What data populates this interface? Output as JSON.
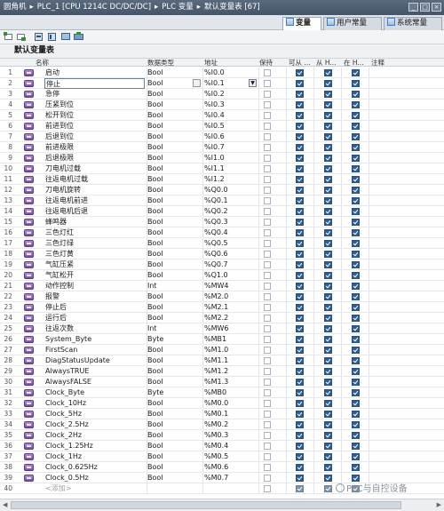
{
  "breadcrumb": [
    "圆角机",
    "PLC_1 [CPU 1214C DC/DC/DC]",
    "PLC 变量",
    "默认变量表 [67]"
  ],
  "tabs": [
    {
      "label": "变量",
      "active": true
    },
    {
      "label": "用户常量",
      "active": false
    },
    {
      "label": "系统常量",
      "active": false
    }
  ],
  "table_title": "默认变量表",
  "columns": {
    "name": "名称",
    "type": "数据类型",
    "address": "地址",
    "retain": "保持",
    "access": "可从 ...",
    "write": "从 H...",
    "visible": "在 H...",
    "comment": "注释"
  },
  "rows": [
    {
      "n": "1",
      "name": "启动",
      "type": "Bool",
      "addr": "%I0.0"
    },
    {
      "n": "2",
      "name": "停止",
      "type": "Bool",
      "addr": "%I0.1"
    },
    {
      "n": "3",
      "name": "急停",
      "type": "Bool",
      "addr": "%I0.2"
    },
    {
      "n": "4",
      "name": "压紧到位",
      "type": "Bool",
      "addr": "%I0.3"
    },
    {
      "n": "5",
      "name": "松开到位",
      "type": "Bool",
      "addr": "%I0.4"
    },
    {
      "n": "6",
      "name": "前进到位",
      "type": "Bool",
      "addr": "%I0.5"
    },
    {
      "n": "7",
      "name": "后退到位",
      "type": "Bool",
      "addr": "%I0.6"
    },
    {
      "n": "8",
      "name": "前进极限",
      "type": "Bool",
      "addr": "%I0.7"
    },
    {
      "n": "9",
      "name": "后退极限",
      "type": "Bool",
      "addr": "%I1.0"
    },
    {
      "n": "10",
      "name": "刀电机过载",
      "type": "Bool",
      "addr": "%I1.1"
    },
    {
      "n": "11",
      "name": "往返电机过载",
      "type": "Bool",
      "addr": "%I1.2"
    },
    {
      "n": "12",
      "name": "刀电机旋转",
      "type": "Bool",
      "addr": "%Q0.0"
    },
    {
      "n": "13",
      "name": "往返电机前进",
      "type": "Bool",
      "addr": "%Q0.1"
    },
    {
      "n": "14",
      "name": "往返电机后退",
      "type": "Bool",
      "addr": "%Q0.2"
    },
    {
      "n": "15",
      "name": "蜂鸣器",
      "type": "Bool",
      "addr": "%Q0.3"
    },
    {
      "n": "16",
      "name": "三色灯红",
      "type": "Bool",
      "addr": "%Q0.4"
    },
    {
      "n": "17",
      "name": "三色灯绿",
      "type": "Bool",
      "addr": "%Q0.5"
    },
    {
      "n": "18",
      "name": "三色灯黄",
      "type": "Bool",
      "addr": "%Q0.6"
    },
    {
      "n": "19",
      "name": "气缸压紧",
      "type": "Bool",
      "addr": "%Q0.7"
    },
    {
      "n": "20",
      "name": "气缸松开",
      "type": "Bool",
      "addr": "%Q1.0"
    },
    {
      "n": "21",
      "name": "动作控制",
      "type": "Int",
      "addr": "%MW4"
    },
    {
      "n": "22",
      "name": "报警",
      "type": "Bool",
      "addr": "%M2.0"
    },
    {
      "n": "23",
      "name": "停止后",
      "type": "Bool",
      "addr": "%M2.1"
    },
    {
      "n": "24",
      "name": "运行后",
      "type": "Bool",
      "addr": "%M2.2"
    },
    {
      "n": "25",
      "name": "往返次数",
      "type": "Int",
      "addr": "%MW6"
    },
    {
      "n": "26",
      "name": "System_Byte",
      "type": "Byte",
      "addr": "%MB1"
    },
    {
      "n": "27",
      "name": "FirstScan",
      "type": "Bool",
      "addr": "%M1.0"
    },
    {
      "n": "28",
      "name": "DiagStatusUpdate",
      "type": "Bool",
      "addr": "%M1.1"
    },
    {
      "n": "29",
      "name": "AlwaysTRUE",
      "type": "Bool",
      "addr": "%M1.2"
    },
    {
      "n": "30",
      "name": "AlwaysFALSE",
      "type": "Bool",
      "addr": "%M1.3"
    },
    {
      "n": "31",
      "name": "Clock_Byte",
      "type": "Byte",
      "addr": "%MB0"
    },
    {
      "n": "32",
      "name": "Clock_10Hz",
      "type": "Bool",
      "addr": "%M0.0"
    },
    {
      "n": "33",
      "name": "Clock_5Hz",
      "type": "Bool",
      "addr": "%M0.1"
    },
    {
      "n": "34",
      "name": "Clock_2.5Hz",
      "type": "Bool",
      "addr": "%M0.2"
    },
    {
      "n": "35",
      "name": "Clock_2Hz",
      "type": "Bool",
      "addr": "%M0.3"
    },
    {
      "n": "36",
      "name": "Clock_1.25Hz",
      "type": "Bool",
      "addr": "%M0.4"
    },
    {
      "n": "37",
      "name": "Clock_1Hz",
      "type": "Bool",
      "addr": "%M0.5"
    },
    {
      "n": "38",
      "name": "Clock_0.625Hz",
      "type": "Bool",
      "addr": "%M0.6"
    },
    {
      "n": "39",
      "name": "Clock_0.5Hz",
      "type": "Bool",
      "addr": "%M0.7"
    }
  ],
  "add_row": {
    "n": "40",
    "name": "<添加>"
  },
  "selected_row": "2",
  "watermark": "PLC与自控设备",
  "colors": {
    "titlebar": "#4f5f72",
    "tag_icon": "#8a5cb0",
    "checkbox": "#2f5d92"
  }
}
